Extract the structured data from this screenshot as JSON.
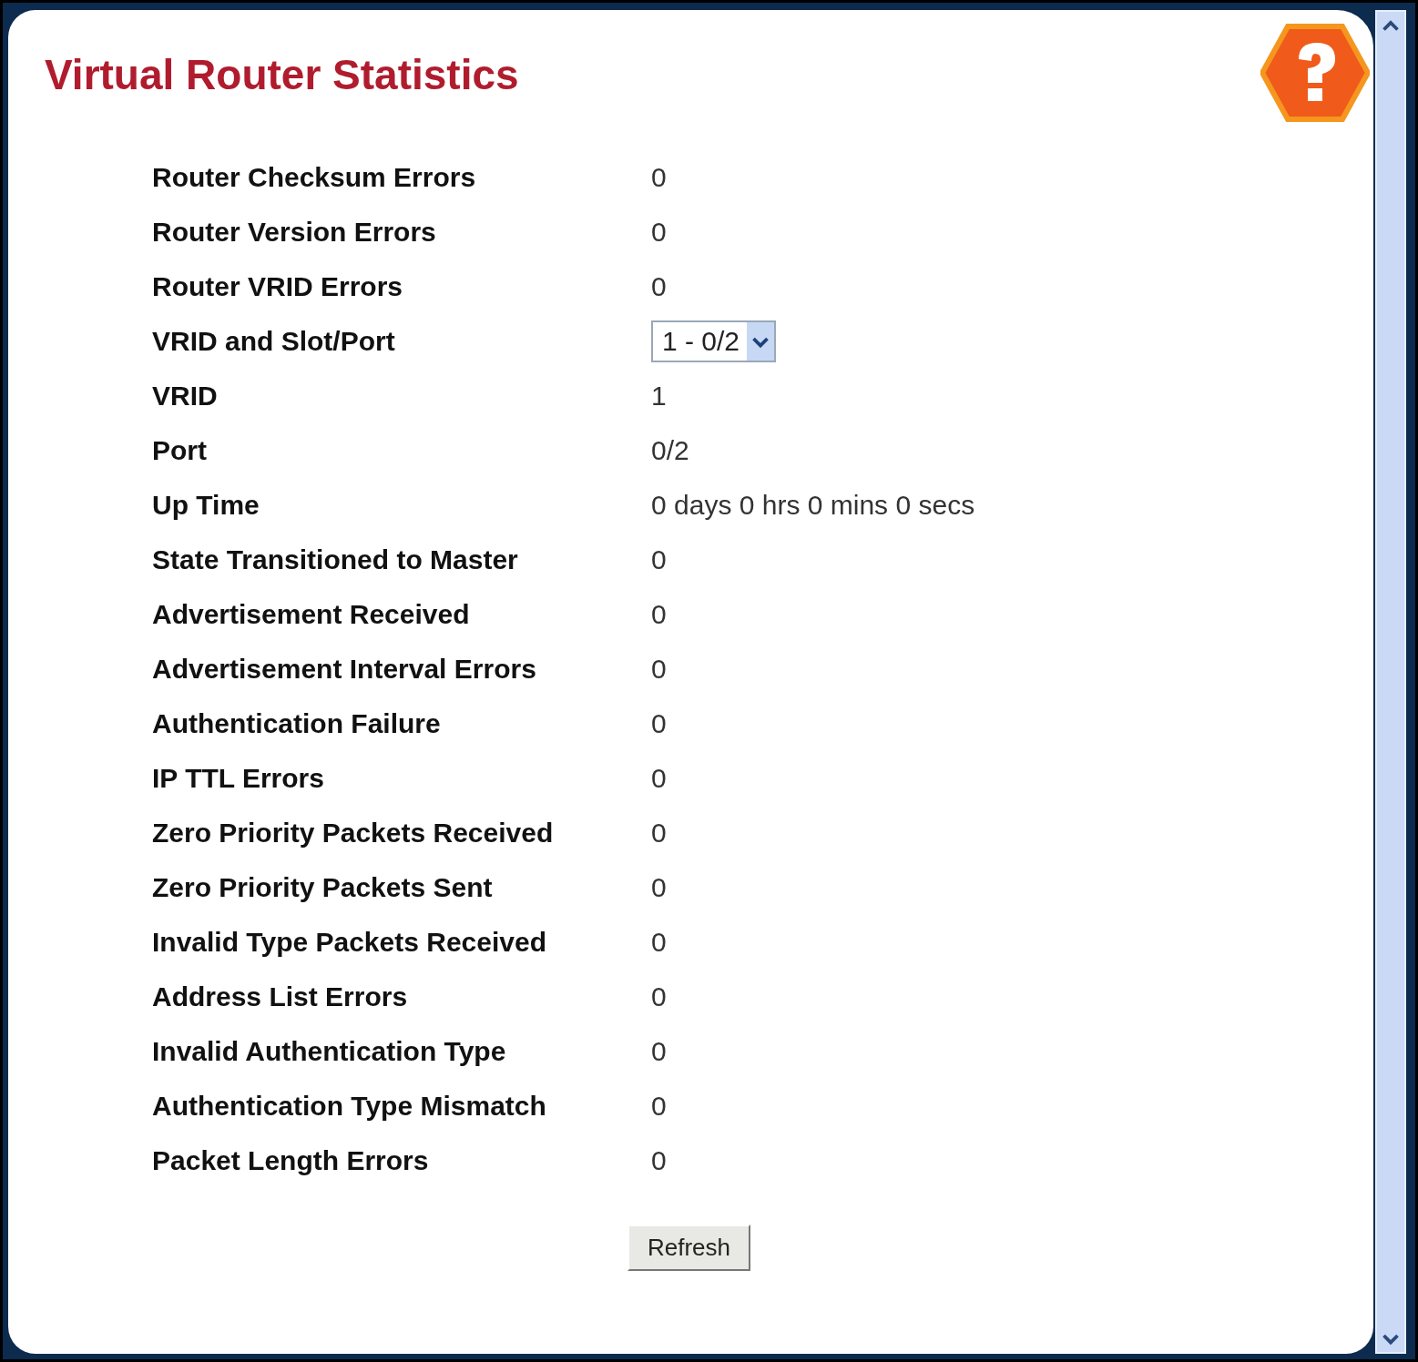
{
  "title": "Virtual Router Statistics",
  "rows": [
    {
      "kind": "text",
      "label": "Router Checksum Errors",
      "value": "0"
    },
    {
      "kind": "text",
      "label": "Router Version Errors",
      "value": "0"
    },
    {
      "kind": "text",
      "label": "Router VRID Errors",
      "value": "0"
    },
    {
      "kind": "select",
      "label": "VRID and Slot/Port",
      "value": "1 - 0/2"
    },
    {
      "kind": "text",
      "label": "VRID",
      "value": "1"
    },
    {
      "kind": "text",
      "label": "Port",
      "value": "0/2"
    },
    {
      "kind": "text",
      "label": "Up Time",
      "value": "0 days 0 hrs 0 mins 0 secs"
    },
    {
      "kind": "text",
      "label": "State Transitioned to Master",
      "value": "0"
    },
    {
      "kind": "text",
      "label": "Advertisement Received",
      "value": "0"
    },
    {
      "kind": "text",
      "label": "Advertisement Interval Errors",
      "value": "0"
    },
    {
      "kind": "text",
      "label": "Authentication Failure",
      "value": "0"
    },
    {
      "kind": "text",
      "label": "IP TTL Errors",
      "value": "0"
    },
    {
      "kind": "text",
      "label": "Zero Priority Packets Received",
      "value": "0"
    },
    {
      "kind": "text",
      "label": "Zero Priority Packets Sent",
      "value": "0"
    },
    {
      "kind": "text",
      "label": "Invalid Type Packets Received",
      "value": "0"
    },
    {
      "kind": "text",
      "label": "Address List Errors",
      "value": "0"
    },
    {
      "kind": "text",
      "label": "Invalid Authentication Type",
      "value": "0"
    },
    {
      "kind": "text",
      "label": "Authentication Type Mismatch",
      "value": "0"
    },
    {
      "kind": "text",
      "label": "Packet Length Errors",
      "value": "0"
    }
  ],
  "button": "Refresh"
}
